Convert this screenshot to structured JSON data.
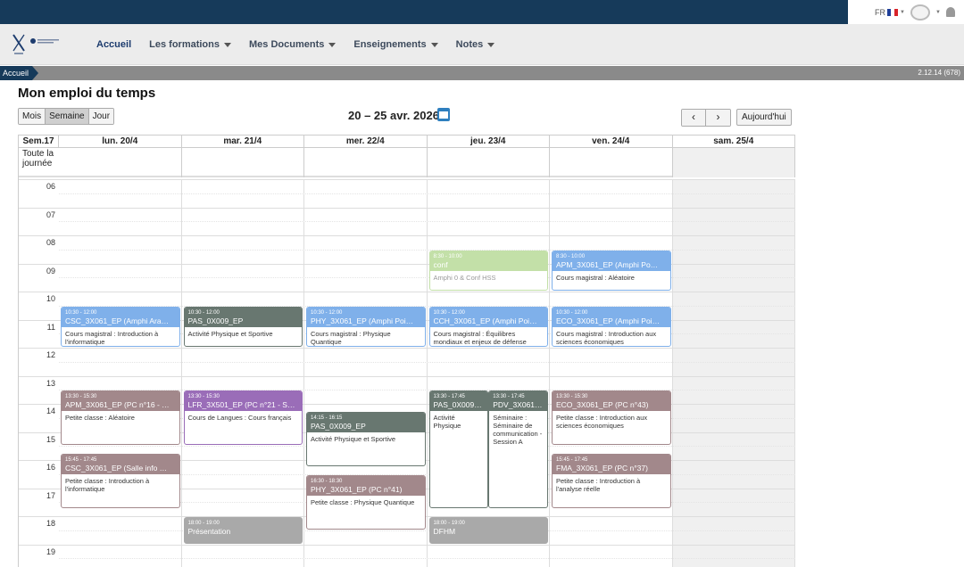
{
  "topbar": {
    "lang": "FR"
  },
  "nav": {
    "items": [
      {
        "label": "Accueil",
        "active": true,
        "dropdown": false
      },
      {
        "label": "Les formations",
        "active": false,
        "dropdown": true
      },
      {
        "label": "Mes Documents",
        "active": false,
        "dropdown": true
      },
      {
        "label": "Enseignements",
        "active": false,
        "dropdown": true
      },
      {
        "label": "Notes",
        "active": false,
        "dropdown": true
      }
    ]
  },
  "breadcrumb": "Accueil",
  "version": "2.12.14 (678)",
  "page_title": "Mon emploi du temps",
  "views": [
    "Mois",
    "Semaine",
    "Jour"
  ],
  "active_view": "Semaine",
  "date_range": "20 – 25 avr. 2026",
  "today_label": "Aujourd'hui",
  "calendar": {
    "week_label": "Sem.17",
    "allday_label": "Toute la journée",
    "days": [
      "lun. 20/4",
      "mar. 21/4",
      "mer. 22/4",
      "jeu. 23/4",
      "ven. 24/4",
      "sam. 25/4"
    ],
    "hours": [
      "06",
      "07",
      "08",
      "09",
      "10",
      "11",
      "12",
      "13",
      "14",
      "15",
      "16",
      "17",
      "18",
      "19"
    ],
    "events": [
      {
        "day": 0,
        "start": "10:30",
        "end": "12:00",
        "time": "10:30 - 12:00",
        "title": "CSC_3X061_EP (Amphi Ara…",
        "desc": "Cours magistral : Introduction à l'informatique",
        "color": "#7fb0ea"
      },
      {
        "day": 1,
        "start": "10:30",
        "end": "12:00",
        "time": "10:30 - 12:00",
        "title": "PAS_0X009_EP",
        "desc": "Activité Physique et Sportive",
        "color": "#687770"
      },
      {
        "day": 2,
        "start": "10:30",
        "end": "12:00",
        "time": "10:30 - 12:00",
        "title": "PHY_3X061_EP (Amphi Poi…",
        "desc": "Cours magistral : Physique Quantique",
        "color": "#7fb0ea"
      },
      {
        "day": 3,
        "start": "08:30",
        "end": "10:00",
        "time": "8:30 - 10:00",
        "title": "conf",
        "desc": "Amphi 0 & Conf HSS",
        "color": "#c3e0a8",
        "muted": true
      },
      {
        "day": 3,
        "start": "10:30",
        "end": "12:00",
        "time": "10:30 - 12:00",
        "title": "CCH_3X061_EP (Amphi Poi…",
        "desc": "Cours magistral : Équilibres mondiaux et enjeux de défense",
        "color": "#7fb0ea"
      },
      {
        "day": 4,
        "start": "08:30",
        "end": "10:00",
        "time": "8:30 - 10:00",
        "title": "APM_3X061_EP (Amphi Po…",
        "desc": "Cours magistral : Aléatoire",
        "color": "#7fb0ea"
      },
      {
        "day": 4,
        "start": "10:30",
        "end": "12:00",
        "time": "10:30 - 12:00",
        "title": "ECO_3X061_EP (Amphi Poi…",
        "desc": "Cours magistral : Introduction aux sciences économiques",
        "color": "#7fb0ea"
      },
      {
        "day": 0,
        "start": "13:30",
        "end": "15:30",
        "time": "13:30 - 15:30",
        "title": "APM_3X061_EP (PC n°16 - …",
        "desc": "Petite classe : Aléatoire",
        "color": "#a2888b"
      },
      {
        "day": 1,
        "start": "13:30",
        "end": "15:30",
        "time": "13:30 - 15:30",
        "title": "LFR_3X501_EP (PC n°21 - S…",
        "desc": "Cours de Langues : Cours français",
        "color": "#9a6db8"
      },
      {
        "day": 2,
        "start": "14:15",
        "end": "16:15",
        "time": "14:15 - 16:15",
        "title": "PAS_0X009_EP",
        "desc": "Activité Physique et Sportive",
        "color": "#687770"
      },
      {
        "day": 3,
        "start": "13:30",
        "end": "17:45",
        "time": "13:30 - 17:45",
        "title": "PAS_0X009_EP",
        "desc": "Activité Physique",
        "color": "#687770",
        "half": "left"
      },
      {
        "day": 3,
        "start": "13:30",
        "end": "17:45",
        "time": "13:30 - 17:45",
        "title": "PDV_3X061…",
        "desc": "Séminaire : Séminaire de communication - Session A",
        "color": "#687770",
        "half": "right"
      },
      {
        "day": 4,
        "start": "13:30",
        "end": "15:30",
        "time": "13:30 - 15:30",
        "title": "ECO_3X061_EP (PC n°43)",
        "desc": "Petite classe : Introduction aux sciences économiques",
        "color": "#a2888b"
      },
      {
        "day": 0,
        "start": "15:45",
        "end": "17:45",
        "time": "15:45 - 17:45",
        "title": "CSC_3X061_EP (Salle info …",
        "desc": "Petite classe : Introduction à l'informatique",
        "color": "#a2888b"
      },
      {
        "day": 2,
        "start": "16:30",
        "end": "18:30",
        "time": "16:30 - 18:30",
        "title": "PHY_3X061_EP (PC n°41)",
        "desc": "Petite classe : Physique Quantique",
        "color": "#a2888b"
      },
      {
        "day": 4,
        "start": "15:45",
        "end": "17:45",
        "time": "15:45 - 17:45",
        "title": "FMA_3X061_EP (PC n°37)",
        "desc": "Petite classe : Introduction à l'analyse réelle",
        "color": "#a2888b"
      },
      {
        "day": 1,
        "start": "18:00",
        "end": "19:00",
        "time": "18:00 - 19:00",
        "title": "Présentation",
        "desc": "",
        "color": "#a9a9a9"
      },
      {
        "day": 3,
        "start": "18:00",
        "end": "19:00",
        "time": "18:00 - 19:00",
        "title": "DFHM",
        "desc": "",
        "color": "#a9a9a9"
      }
    ]
  }
}
